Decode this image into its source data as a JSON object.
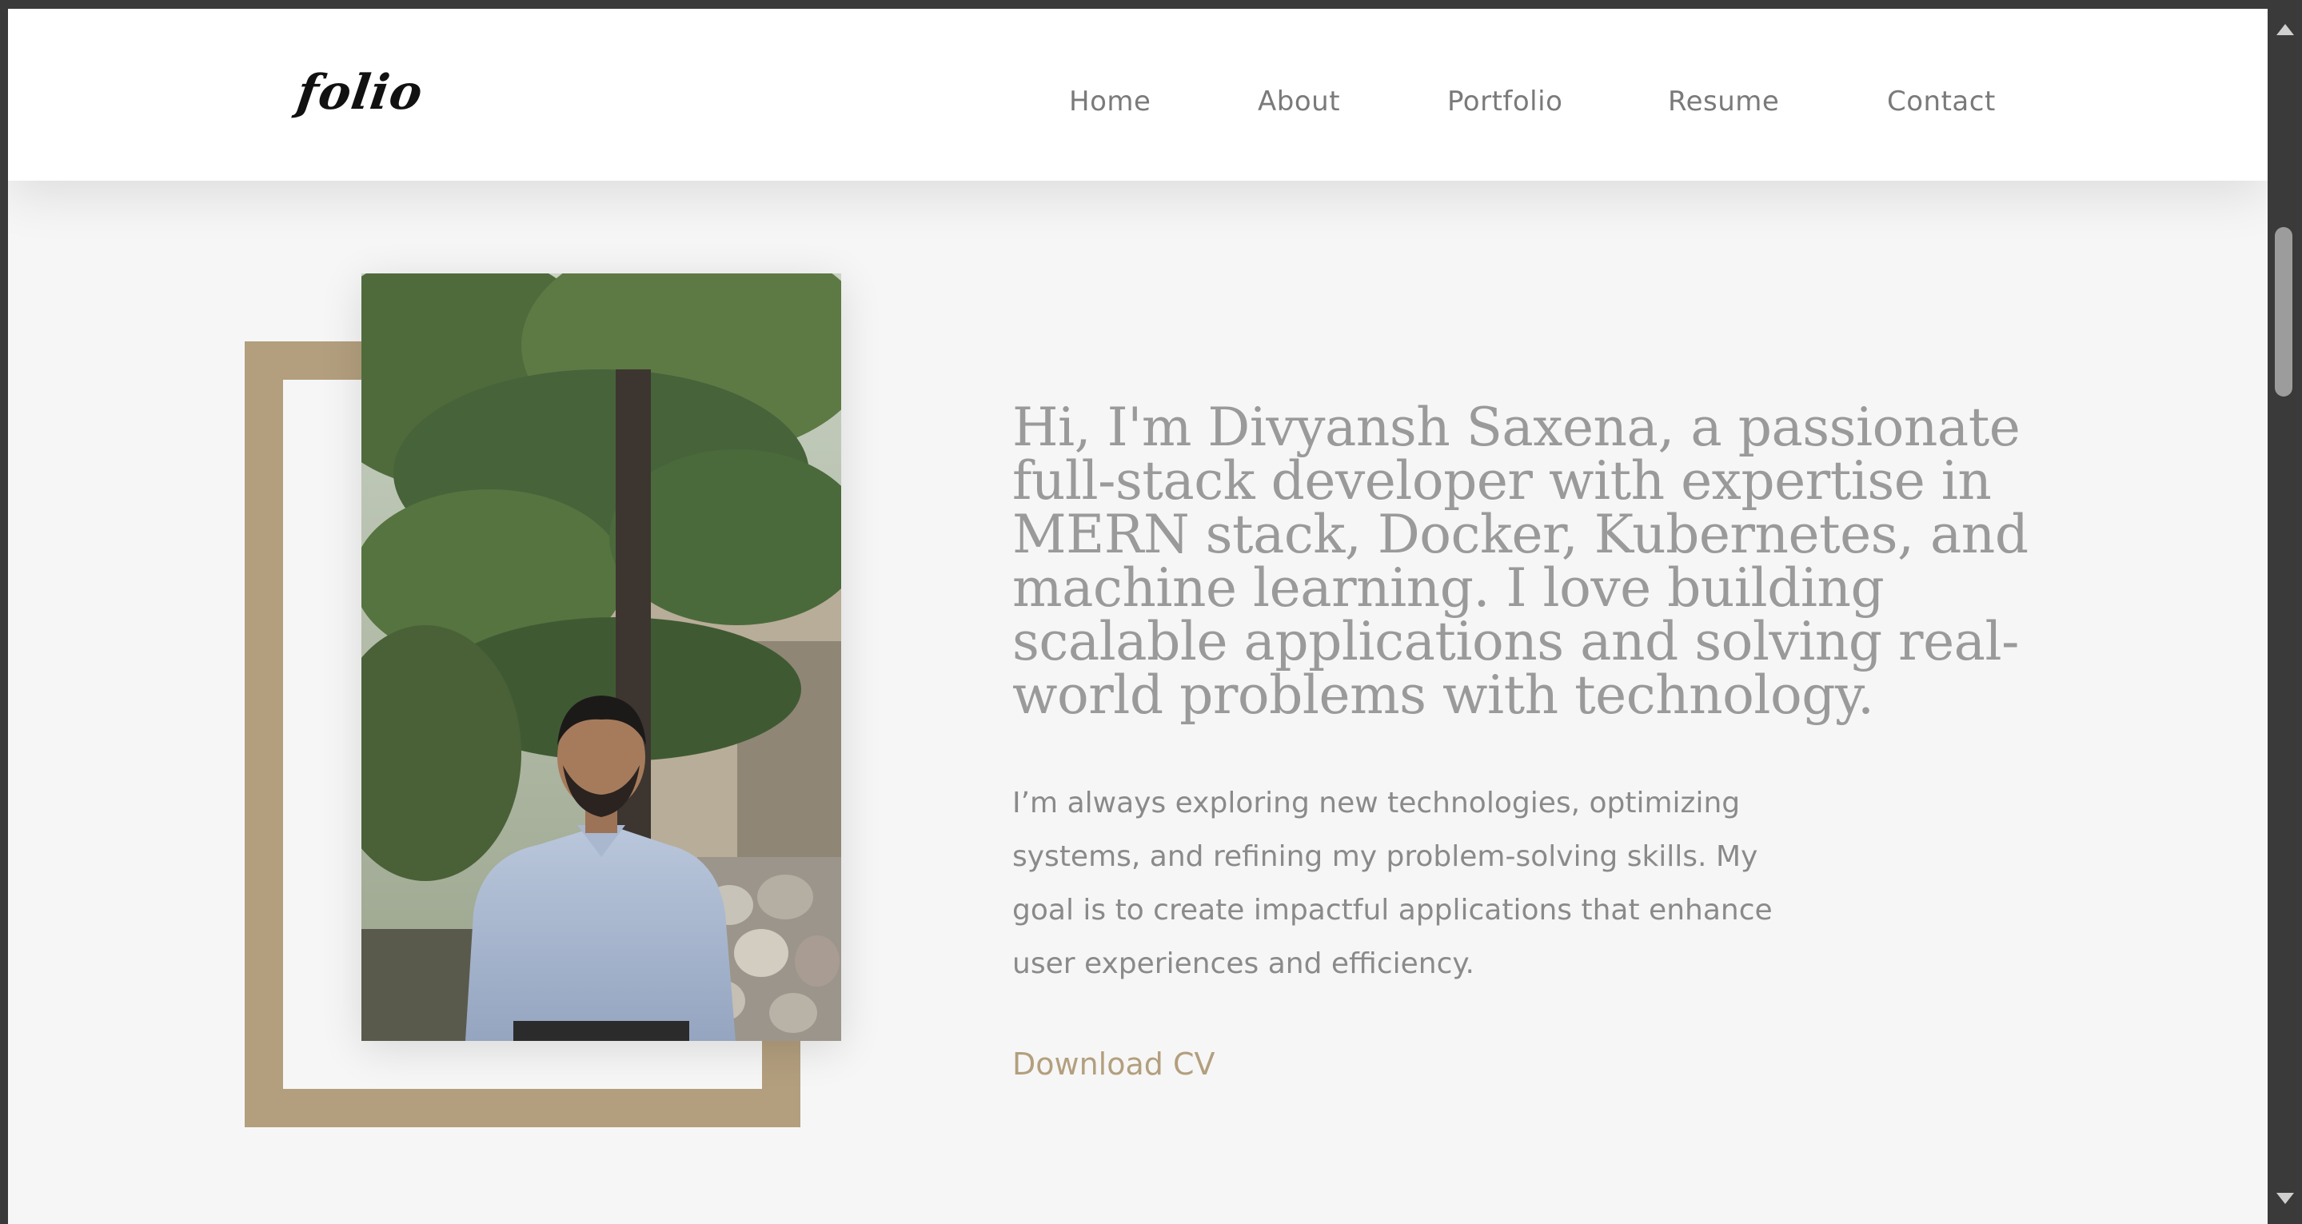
{
  "header": {
    "logo": "folio",
    "nav": [
      {
        "label": "Home"
      },
      {
        "label": "About"
      },
      {
        "label": "Portfolio"
      },
      {
        "label": "Resume"
      },
      {
        "label": "Contact"
      }
    ]
  },
  "hero": {
    "headline": "Hi, I'm Divyansh Saxena, a passionate full-stack developer with expertise in MERN stack, Docker, Kubernetes, and machine learning. I love building scalable applications and solving real-world problems with technology.",
    "paragraph": "I’m always exploring new technologies, optimizing systems, and refining my problem-solving skills. My goal is to create impactful applications that enhance user experiences and efficiency.",
    "cta_label": "Download CV"
  },
  "colors": {
    "accent": "#b39f7e",
    "text_muted": "#9a9a9a",
    "background": "#f6f6f6"
  }
}
